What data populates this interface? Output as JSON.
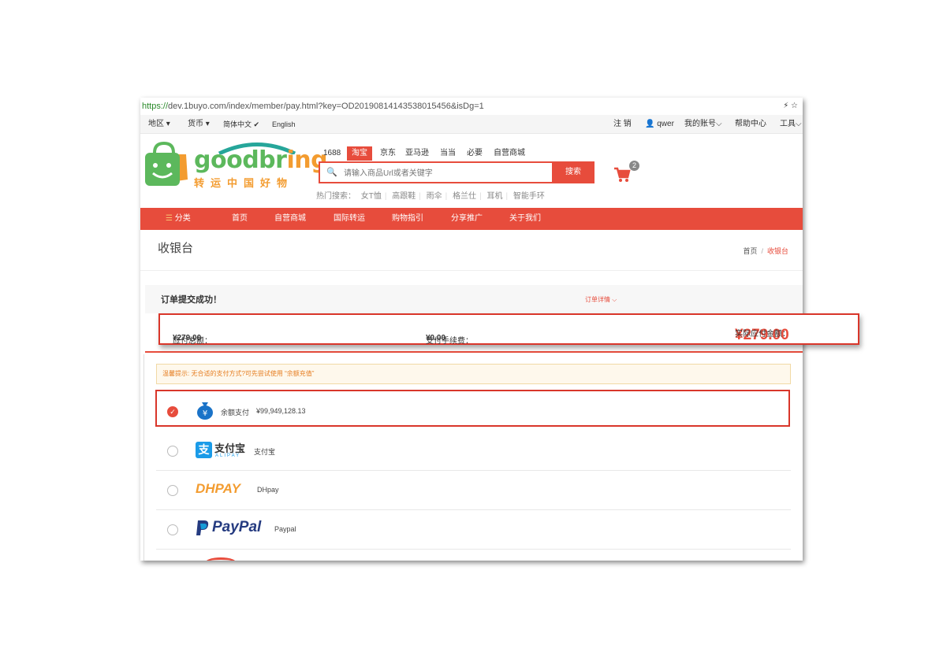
{
  "browser": {
    "url_protocol": "https://",
    "url_rest": "dev.1buyo.com/index/member/pay.html?key=OD20190814143538015456&isDg=1",
    "icons": "⚡ ☆"
  },
  "topbar": {
    "region": "地区",
    "currency": "货币",
    "language": "简体中文",
    "english": "English",
    "logout": "注 销",
    "user": "qwer",
    "account": "我的账号",
    "help": "帮助中心",
    "tools": "工具"
  },
  "logo": {
    "text_a": "goodbr",
    "text_b": "ing",
    "subtitle": "转运中国好物"
  },
  "search": {
    "tabs": [
      "1688",
      "淘宝",
      "京东",
      "亚马逊",
      "当当",
      "必要",
      "自营商城"
    ],
    "active_tab": "淘宝",
    "placeholder": "请输入商品Url或者关键字",
    "button": "搜索",
    "hot_label": "热门搜索：",
    "hot_items": [
      "女T恤",
      "高跟鞋",
      "雨伞",
      "格兰仕",
      "耳机",
      "智能手环"
    ]
  },
  "cart": {
    "count": "2"
  },
  "nav": {
    "category": "分类",
    "items": [
      "首页",
      "自营商城",
      "国际转运",
      "购物指引",
      "分享推广",
      "关于我们"
    ]
  },
  "page": {
    "title": "收银台",
    "breadcrumb_home": "首页",
    "breadcrumb_sep": "/",
    "breadcrumb_current": "收银台"
  },
  "order": {
    "success": "订单提交成功！",
    "detail_link": "订单详情",
    "total_label": "应付总额：",
    "total_value": "¥279.00",
    "fee_label": "支付手续费：",
    "fee_value": "¥0.00",
    "actual_label": "实际应付金额：",
    "actual_value": "¥279.00"
  },
  "tip": "温馨提示: 无合适的支付方式?可先尝试使用 “余额充值”",
  "payments": [
    {
      "name": "余额支付",
      "extra": "¥99,949,128.13",
      "selected": true,
      "icon": "money-bag-icon"
    },
    {
      "name": "支付宝",
      "logo": "支付宝",
      "logo_sub": "ALIPAY",
      "selected": false,
      "icon": "alipay-icon"
    },
    {
      "name": "DHpay",
      "logo": "DHPAY",
      "selected": false,
      "icon": "dhpay-logo"
    },
    {
      "name": "Paypal",
      "logo": "PayPal",
      "selected": false,
      "icon": "paypal-logo"
    }
  ],
  "colors": {
    "accent": "#e74c3c",
    "brand_green": "#5cb85c",
    "brand_orange": "#f39c30",
    "alipay_blue": "#1a9be8",
    "paypal_dark": "#253b80",
    "paypal_light": "#179bd7"
  }
}
